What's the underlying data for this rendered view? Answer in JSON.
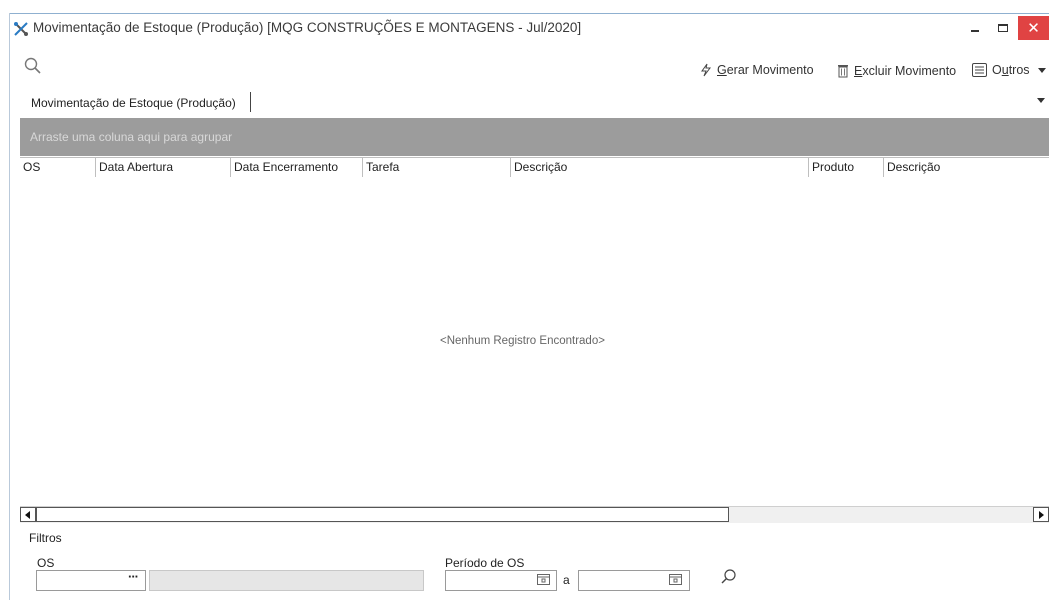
{
  "window": {
    "title": "Movimentação de Estoque (Produção) [MQG CONSTRUÇÕES E MONTAGENS - Jul/2020]",
    "close_glyph": "✕"
  },
  "toolbar": {
    "gerar_prefix": "",
    "gerar_hotkey": "G",
    "gerar_rest": "erar Movimento",
    "excluir_hotkey": "E",
    "excluir_rest": "xcluir Movimento",
    "outros_prefix": "O",
    "outros_hotkey": "u",
    "outros_rest": "tros"
  },
  "tab": {
    "label": "Movimentação de Estoque (Produção)"
  },
  "grid": {
    "group_panel_text": "Arraste uma coluna aqui para agrupar",
    "columns": [
      "OS",
      "Data Abertura",
      "Data Encerramento",
      "Tarefa",
      "Descrição",
      "Produto",
      "Descrição"
    ],
    "empty_message": "<Nenhum Registro Encontrado>"
  },
  "filters": {
    "section_label": "Filtros",
    "os_label": "OS",
    "os_value": "",
    "os_browse": "···",
    "periodo_label": "Período de OS",
    "date_from": "",
    "date_separator": "a",
    "date_to": ""
  },
  "colors": {
    "group_panel_bg": "#9c9c9c",
    "close_button_bg": "#e04343",
    "accent_icon": "#2a7bc4"
  },
  "icons": [
    "app-icon",
    "search-icon",
    "lightning-icon",
    "trash-icon",
    "list-icon",
    "chevron-down-icon",
    "calendar-icon"
  ]
}
